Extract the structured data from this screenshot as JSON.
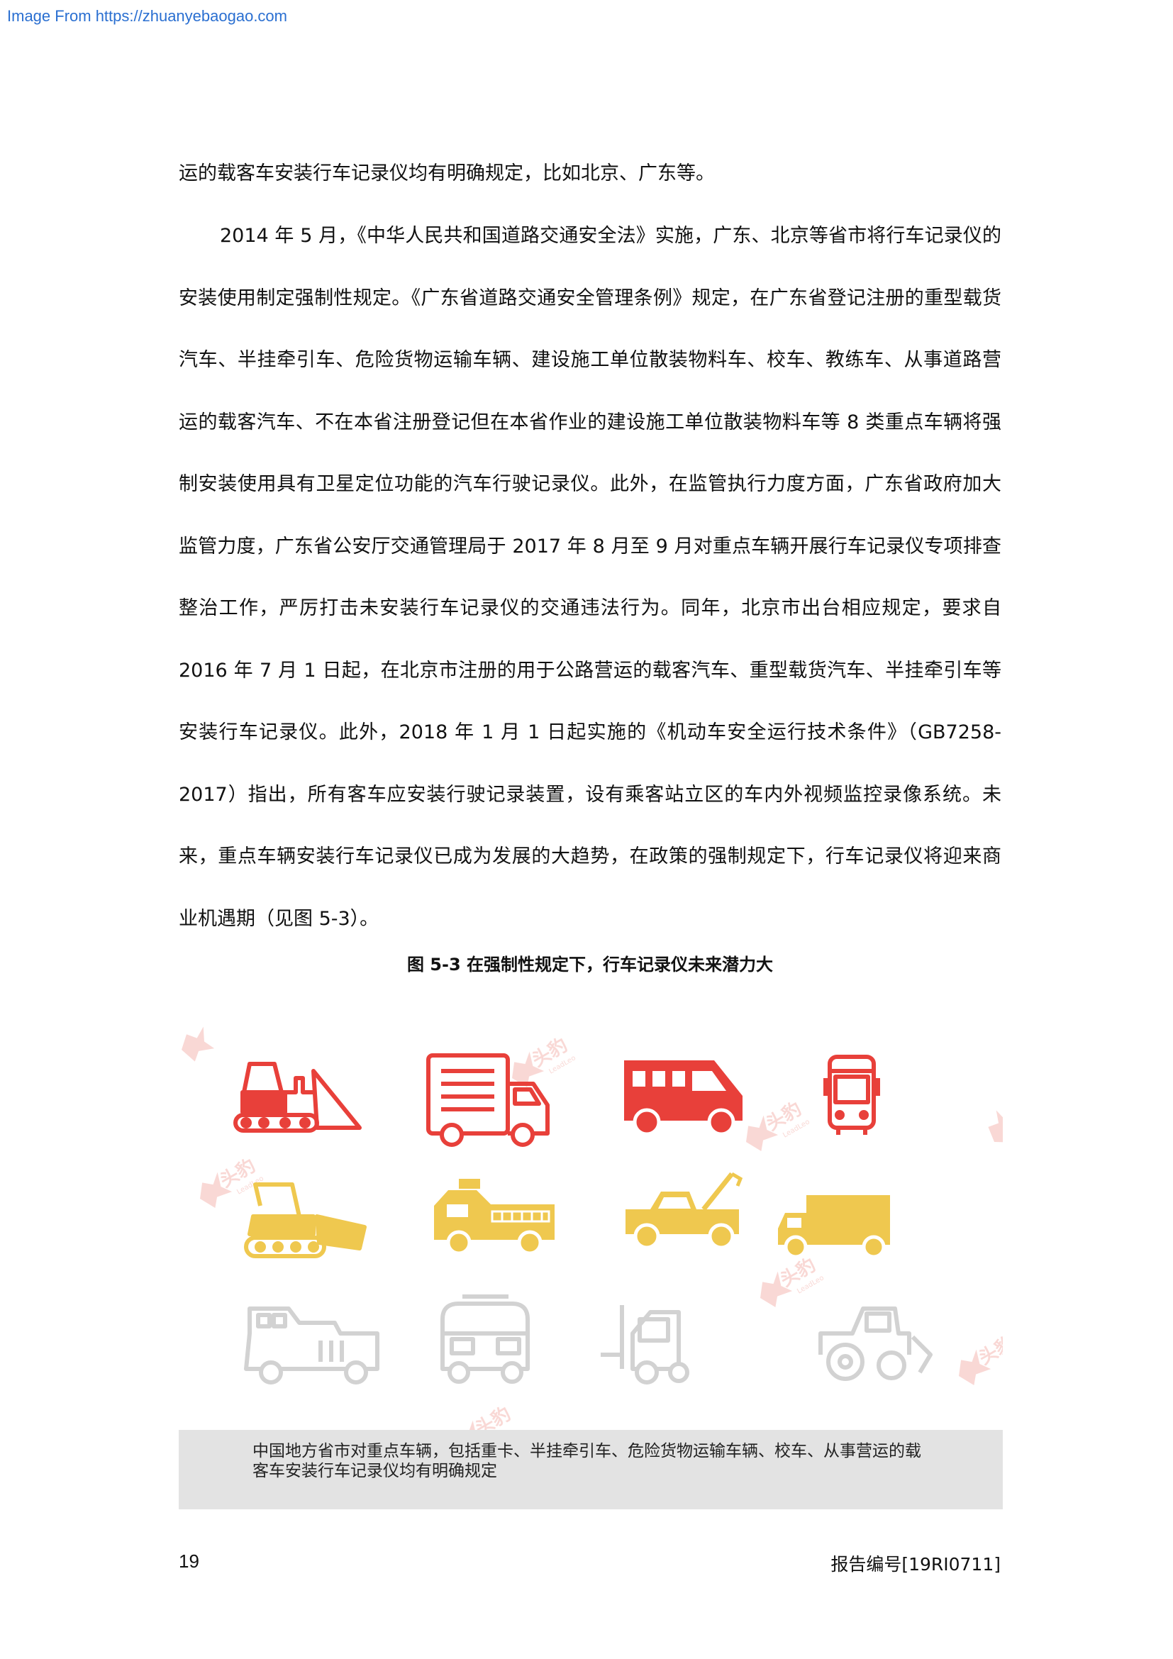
{
  "header": {
    "source_link": "Image From https://zhuanyebaogao.com"
  },
  "body": {
    "paragraph_1": "运的载客车安装行车记录仪均有明确规定，比如北京、广东等。",
    "paragraph_2": "2014 年 5 月，《中华人民共和国道路交通安全法》实施，广东、北京等省市将行车记录仪的安装使用制定强制性规定。《广东省道路交通安全管理条例》规定，在广东省登记注册的重型载货汽车、半挂牵引车、危险货物运输车辆、建设施工单位散装物料车、校车、教练车、从事道路营运的载客汽车、不在本省注册登记但在本省作业的建设施工单位散装物料车等 8 类重点车辆将强制安装使用具有卫星定位功能的汽车行驶记录仪。此外，在监管执行力度方面，广东省政府加大监管力度，广东省公安厅交通管理局于 2017 年 8 月至 9 月对重点车辆开展行车记录仪专项排查整治工作，严厉打击未安装行车记录仪的交通违法行为。同年，北京市出台相应规定，要求自 2016 年 7 月 1 日起，在北京市注册的用于公路营运的载客汽车、重型载货汽车、半挂牵引车等安装行车记录仪。此外，2018 年 1 月 1 日起实施的《机动车安全运行技术条件》（GB7258-2017）指出，所有客车应安装行驶记录装置，设有乘客站立区的车内外视频监控录像系统。未来，重点车辆安装行车记录仪已成为发展的大趋势，在政策的强制规定下，行车记录仪将迎来商业机遇期（见图 5-3）。"
  },
  "figure": {
    "caption": "图 5-3  在强制性规定下，行车记录仪未来潜力大",
    "note": "中国地方省市对重点车辆，包括重卡、半挂牵引车、危险货物运输车辆、校车、从事营运的载客车安装行车记录仪均有明确规定",
    "watermark_logo": "头豹 LeadLeo",
    "colors": {
      "red": "#e8403a",
      "yellow": "#efc84f",
      "gray": "#d2d2d2",
      "note_bg": "#e3e3e3"
    },
    "icons": [
      "bulldozer-icon-red",
      "cargo-truck-icon-red",
      "van-icon-red",
      "bus-icon-red",
      "bulldozer-icon-yellow",
      "fire-truck-icon-yellow",
      "tow-truck-icon-yellow",
      "box-truck-icon-yellow",
      "jeep-icon-gray",
      "minibus-icon-gray",
      "forklift-icon-gray",
      "tractor-icon-gray"
    ]
  },
  "footer": {
    "page_number": "19",
    "report_number": "报告编号[19RI0711]"
  }
}
